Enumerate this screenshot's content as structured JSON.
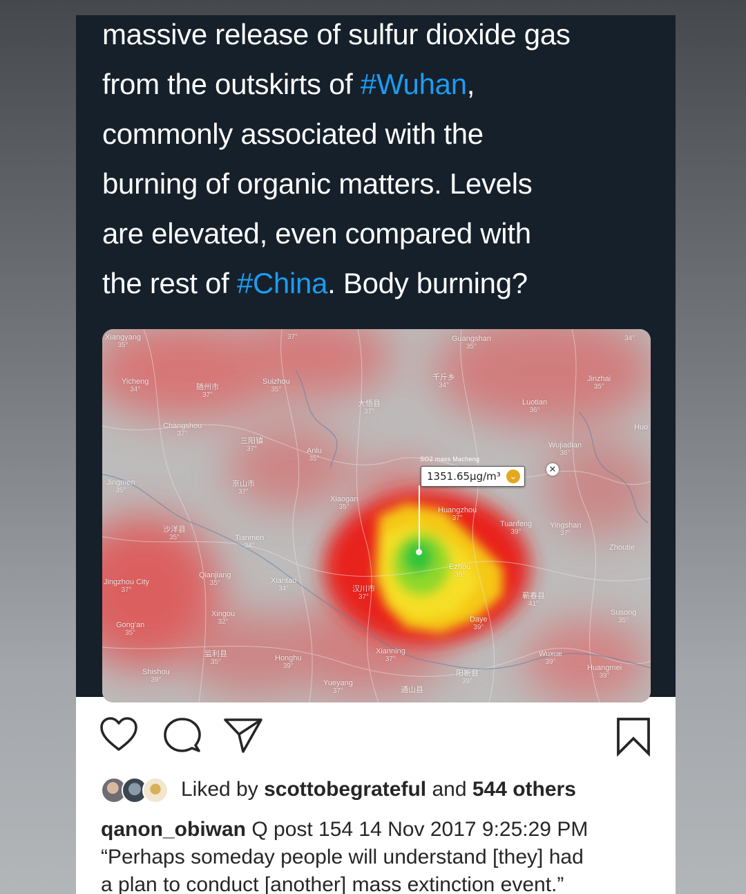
{
  "tweet": {
    "lines": [
      {
        "pre": "massive release of sulfur dioxide gas",
        "tag": "",
        "post": ""
      },
      {
        "pre": "from the outskirts of ",
        "tag": "#Wuhan",
        "post": ","
      },
      {
        "pre": "commonly associated with the",
        "tag": "",
        "post": ""
      },
      {
        "pre": "burning of organic matters. Levels",
        "tag": "",
        "post": ""
      },
      {
        "pre": "are elevated, even compared with",
        "tag": "",
        "post": ""
      },
      {
        "pre": "the rest of ",
        "tag": "#China",
        "post": ". Body burning?"
      }
    ],
    "hashtag_color": "#1d9bf0",
    "background": "#15202b"
  },
  "map": {
    "tooltip_caption": "SO2 mass  Macheng",
    "tooltip_value": "1351.65µg/m³",
    "labels": [
      {
        "name": "Xiangyang",
        "temp": "35°"
      },
      {
        "name": "Yicheng",
        "temp": "34°"
      },
      {
        "name": "随州市",
        "temp": "37°"
      },
      {
        "name": "Suizhou",
        "temp": "35°"
      },
      {
        "name": "",
        "temp": "37°"
      },
      {
        "name": "Guangshan",
        "temp": "35°"
      },
      {
        "name": "",
        "temp": "34°"
      },
      {
        "name": "千斤乡",
        "temp": "34°"
      },
      {
        "name": "大悟县",
        "temp": "37°"
      },
      {
        "name": "Changshou",
        "temp": "37°"
      },
      {
        "name": "三阳镇",
        "temp": "37°"
      },
      {
        "name": "Anlu",
        "temp": "35°"
      },
      {
        "name": "Jingmen",
        "temp": "35°"
      },
      {
        "name": "京山市",
        "temp": "37°"
      },
      {
        "name": "Xiaogan",
        "temp": "35°"
      },
      {
        "name": "Tianmen",
        "temp": "34°"
      },
      {
        "name": "沙洋县",
        "temp": "35°"
      },
      {
        "name": "Qianjiang",
        "temp": "35°"
      },
      {
        "name": "Xiantao",
        "temp": "34°"
      },
      {
        "name": "汉川市",
        "temp": "37°"
      },
      {
        "name": "Jingzhou City",
        "temp": "37°"
      },
      {
        "name": "Gong'an",
        "temp": "35°"
      },
      {
        "name": "Shishou",
        "temp": "39°"
      },
      {
        "name": "Xingou",
        "temp": "32°"
      },
      {
        "name": "监利县",
        "temp": "35°"
      },
      {
        "name": "Honghu",
        "temp": "39°"
      },
      {
        "name": "Xianning",
        "temp": "37°"
      },
      {
        "name": "Daye",
        "temp": "39°"
      },
      {
        "name": "蕲春县",
        "temp": "41°"
      },
      {
        "name": "Tuanfeng",
        "temp": "39°"
      },
      {
        "name": "Yingshan",
        "temp": "37°"
      },
      {
        "name": "Susong",
        "temp": "35°"
      },
      {
        "name": "Wuxue",
        "temp": "39°"
      },
      {
        "name": "Jinzhai",
        "temp": "35°"
      },
      {
        "name": "Wujiadian",
        "temp": "36°"
      },
      {
        "name": "Luotian",
        "temp": "36°"
      },
      {
        "name": "Zhoutie",
        "temp": ""
      },
      {
        "name": "Huangzhou",
        "temp": "37°"
      },
      {
        "name": "Ezhou",
        "temp": "38°"
      },
      {
        "name": "通山县",
        "temp": ""
      },
      {
        "name": "阳新县",
        "temp": "39°"
      },
      {
        "name": "Yueyang",
        "temp": "37°"
      },
      {
        "name": "Huangmei",
        "temp": "39°"
      },
      {
        "name": "Huo",
        "temp": ""
      }
    ]
  },
  "actions": {
    "like": "heart-icon",
    "comment": "comment-icon",
    "share": "send-icon",
    "save": "bookmark-icon"
  },
  "likes": {
    "prefix": "Liked by ",
    "user": "scottobegrateful",
    "middle": " and ",
    "count": "544 others"
  },
  "caption": {
    "username": "qanon_obiwan",
    "line1": " Q post 154 14 Nov 2017 9:25:29 PM",
    "line2": "“Perhaps someday people will understand [they] had",
    "line3": "a plan to conduct [another] mass extinction event.”"
  }
}
